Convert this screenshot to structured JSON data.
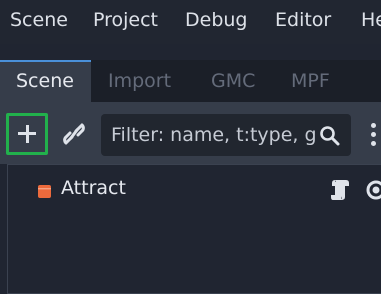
{
  "menubar": {
    "items": [
      "Scene",
      "Project",
      "Debug",
      "Editor",
      "He"
    ]
  },
  "dock": {
    "tabs": [
      {
        "label": "Scene",
        "active": true
      },
      {
        "label": "Import",
        "active": false
      },
      {
        "label": "GMC",
        "active": false
      },
      {
        "label": "MPF",
        "active": false
      }
    ]
  },
  "toolbar": {
    "add_icon": "plus-icon",
    "link_icon": "link-icon",
    "filter_placeholder": "Filter: name, t:type, g:group",
    "search_icon": "search-icon",
    "more_icon": "kebab-menu-icon",
    "highlight_color": "#22b14c"
  },
  "tree": {
    "nodes": [
      {
        "label": "Attract",
        "icon": "control-node-icon",
        "icon_color": "#ec6a3c",
        "has_script": true,
        "visible": true
      }
    ]
  }
}
